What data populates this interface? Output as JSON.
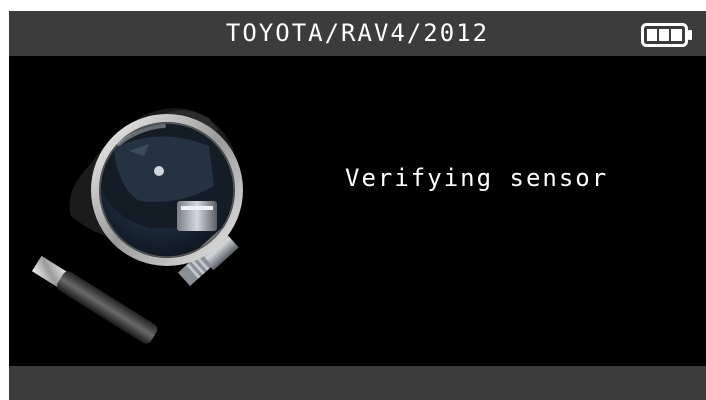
{
  "header": {
    "title": "TOYOTA/RAV4/2012",
    "battery_icon": "battery-full-icon"
  },
  "main": {
    "illustration_icon": "magnifier-sensor-icon",
    "status_message": "Verifying sensor"
  },
  "colors": {
    "screen_background": "#000000",
    "bar_background": "#3c3c3c",
    "text": "#ffffff"
  }
}
